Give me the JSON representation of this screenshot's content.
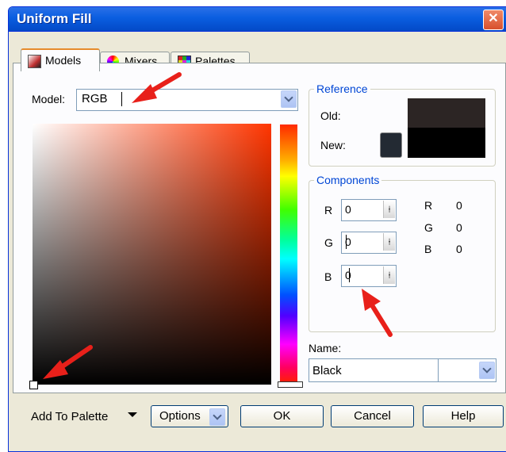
{
  "window": {
    "title": "Uniform Fill",
    "close_glyph": "✕"
  },
  "tabs": [
    {
      "label": "Models",
      "icon": "models-icon",
      "active": true
    },
    {
      "label": "Mixers",
      "icon": "mixers-icon",
      "active": false
    },
    {
      "label": "Palettes",
      "icon": "palettes-icon",
      "active": false
    }
  ],
  "model": {
    "label": "Model:",
    "value": "RGB"
  },
  "reference": {
    "legend": "Reference",
    "old_label": "Old:",
    "new_label": "New:",
    "old_color": "#2c2524",
    "new_color": "#000000"
  },
  "components": {
    "legend": "Components",
    "inputs": [
      {
        "label": "R",
        "value": "0"
      },
      {
        "label": "G",
        "value": "0"
      },
      {
        "label": "B",
        "value": "0"
      }
    ],
    "readout": [
      {
        "label": "R",
        "value": "0"
      },
      {
        "label": "G",
        "value": "0"
      },
      {
        "label": "B",
        "value": "0"
      }
    ]
  },
  "name": {
    "label": "Name:",
    "value": "Black"
  },
  "buttons": {
    "add_to_palette": "Add To Palette",
    "options": "Options",
    "ok": "OK",
    "cancel": "Cancel",
    "help": "Help"
  },
  "colors": {
    "titlebar": "#0a5ee0",
    "hue_top": "#ff2a00",
    "annotation_arrow": "#e8201a"
  }
}
